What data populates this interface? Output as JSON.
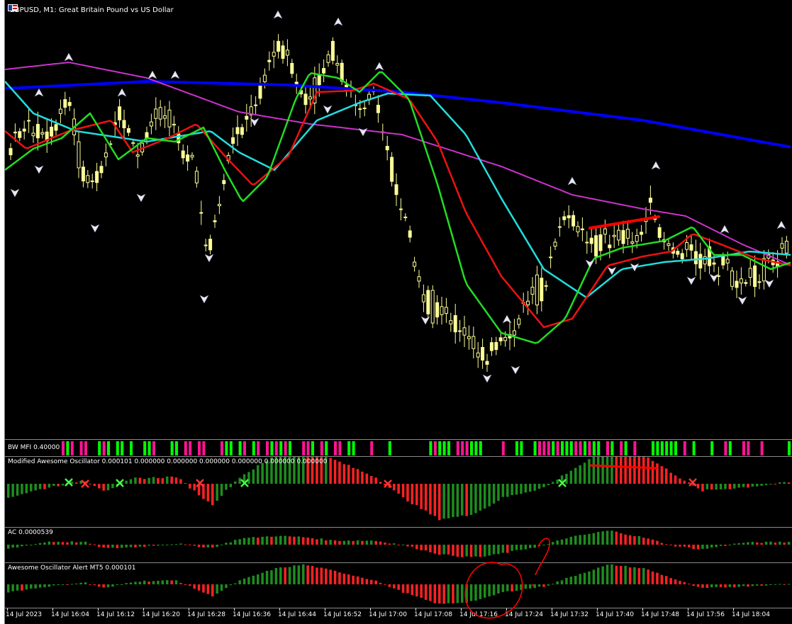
{
  "window": {
    "symbol_title": "GBPUSD, M1:  Great Britain Pound vs US Dollar"
  },
  "icons": {
    "chart_icon": "chart-window-icon",
    "flag_icon": "flag-icon"
  },
  "colors": {
    "background": "#000000",
    "candle": "#ffff99",
    "ma_blue": "#0000ff",
    "ma_magenta": "#cc33cc",
    "ma_cyan": "#22dddd",
    "ma_red": "#ee1111",
    "ma_green": "#22dd22",
    "bar_green": "#1e8c1e",
    "bar_red": "#ff2222",
    "mfi_green": "#00ff00",
    "mfi_pink": "#ff1493",
    "annotation": "#ff0000"
  },
  "panes": {
    "mfi": {
      "label": "BW MFI 0.40000"
    },
    "mao": {
      "label": "Modified Awesome Oscillator 0.000101 0.000000 0.000000 0.000000 0.000000 0.000000 0.000000"
    },
    "ac": {
      "label": "AC 0.0000539"
    },
    "aoa": {
      "label": "Awesome Oscillator Alert MT5 0.000101"
    }
  },
  "time_axis": {
    "labels": [
      "14 Jul 2023",
      "14 Jul 16:04",
      "14 Jul 16:12",
      "14 Jul 16:20",
      "14 Jul 16:28",
      "14 Jul 16:36",
      "14 Jul 16:44",
      "14 Jul 16:52",
      "14 Jul 17:00",
      "14 Jul 17:08",
      "14 Jul 17:16",
      "14 Jul 17:24",
      "14 Jul 17:32",
      "14 Jul 17:40",
      "14 Jul 17:48",
      "14 Jul 17:56",
      "14 Jul 18:04"
    ]
  }
}
